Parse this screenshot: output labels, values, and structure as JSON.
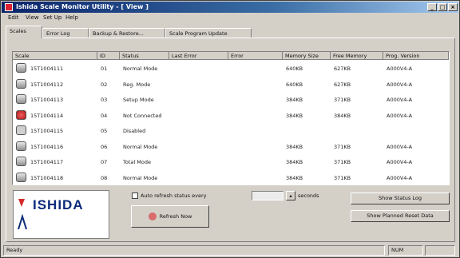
{
  "window": {
    "title": "Ishida Scale Monitor Utility - [ View ]"
  },
  "menu": [
    "Edit",
    "View",
    "Set Up",
    "Help"
  ],
  "tabs": [
    "Scales",
    "Error Log",
    "Backup & Restore...",
    "Scale Program Update"
  ],
  "columns": [
    "Scale",
    "ID",
    "Status",
    "Last Error",
    "Error",
    "Memory Size",
    "Free Memory",
    "Prog. Version"
  ],
  "rows": [
    {
      "scale": "15T1004111",
      "id": "01",
      "status": "Normal Mode",
      "mem": "640KB",
      "free": "627KB",
      "ver": "A000V4-A",
      "icon": "scale"
    },
    {
      "scale": "15T1004112",
      "id": "02",
      "status": "Reg. Mode",
      "mem": "640KB",
      "free": "627KB",
      "ver": "A000V4-A",
      "icon": "scale"
    },
    {
      "scale": "15T1004113",
      "id": "03",
      "status": "Setup Mode",
      "mem": "384KB",
      "free": "371KB",
      "ver": "A000V4-A",
      "icon": "scale"
    },
    {
      "scale": "15T1004114",
      "id": "04",
      "status": "Not Connected",
      "mem": "384KB",
      "free": "384KB",
      "ver": "A000V4-A",
      "icon": "error"
    },
    {
      "scale": "15T1004115",
      "id": "05",
      "status": "Disabled",
      "mem": "",
      "free": "",
      "ver": "",
      "icon": "off"
    },
    {
      "scale": "15T1004116",
      "id": "06",
      "status": "Normal Mode",
      "mem": "384KB",
      "free": "371KB",
      "ver": "A000V4-A",
      "icon": "scale"
    },
    {
      "scale": "15T1004117",
      "id": "07",
      "status": "Total Mode",
      "mem": "384KB",
      "free": "371KB",
      "ver": "A000V4-A",
      "icon": "scale"
    },
    {
      "scale": "15T1004118",
      "id": "08",
      "status": "Normal Mode",
      "mem": "384KB",
      "free": "371KB",
      "ver": "A000V4-A",
      "icon": "scale"
    }
  ],
  "logo": {
    "text": "ISHIDA"
  },
  "controls": {
    "auto_refresh_label": "Auto refresh status every",
    "interval_value": "",
    "seconds_label": "seconds",
    "refresh_button": "Refresh Now",
    "show_status_log": "Show Status Log",
    "show_planned_reset": "Show Planned Reset Data"
  },
  "status": {
    "left": "Ready",
    "right": "NUM"
  },
  "colors": {
    "titlebar": "#0a246a",
    "face": "#d4d0c8",
    "logo_red": "#d52b2b",
    "logo_blue": "#0c2b7a"
  }
}
